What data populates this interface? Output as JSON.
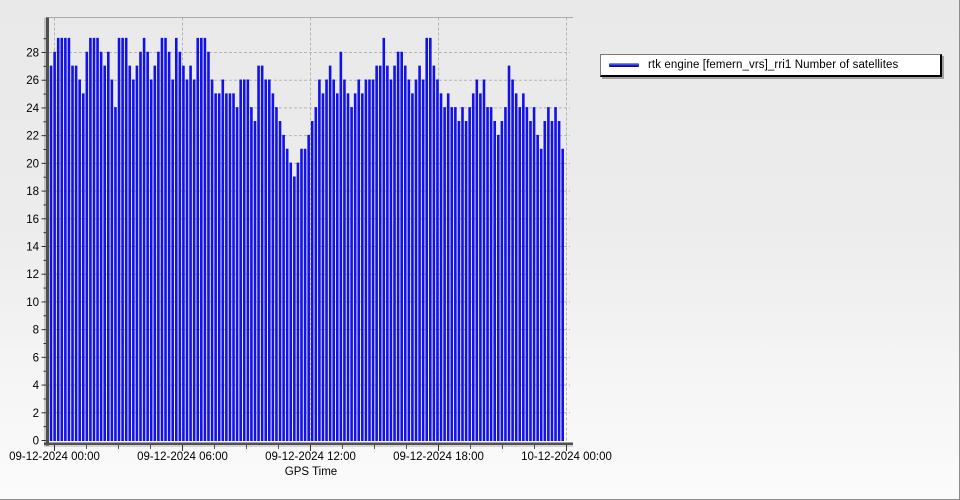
{
  "legend": {
    "label": "rtk engine [femern_vrs]_rri1 Number of satellites",
    "line_color": "#1212e8"
  },
  "chart_data": {
    "type": "line",
    "title": "",
    "xlabel": "GPS Time",
    "ylabel": "",
    "series_name": "rtk engine [femern_vrs]_rri1 Number of satellites",
    "line_color": "#1212e8",
    "grid": "dashed",
    "legend_position": "right-top",
    "ylim": [
      0,
      30.5
    ],
    "y_ticks": [
      0,
      2,
      4,
      6,
      8,
      10,
      12,
      14,
      16,
      18,
      20,
      22,
      24,
      26,
      28
    ],
    "x_tick_labels": [
      "09-12-2024 00:00",
      "09-12-2024 06:00",
      "09-12-2024 12:00",
      "09-12-2024 18:00",
      "10-12-2024 00:00"
    ],
    "x_start": "09-12-2024 00:00",
    "x_end": "10-12-2024 00:00",
    "sample_interval_minutes": 10,
    "note": "signal drops to 0 between samples forming dense comb; values below are the upper envelope (number of satellites)",
    "values": [
      27,
      28,
      29,
      29,
      29,
      29,
      27,
      27,
      26,
      25,
      28,
      29,
      29,
      29,
      28,
      27,
      28,
      26,
      24,
      29,
      29,
      29,
      27,
      26,
      27,
      28,
      29,
      28,
      26,
      27,
      28,
      29,
      29,
      28,
      26,
      29,
      28,
      27,
      26,
      27,
      26,
      29,
      29,
      29,
      28,
      26,
      25,
      25,
      26,
      25,
      25,
      25,
      24,
      26,
      26,
      26,
      24,
      23,
      27,
      27,
      26,
      26,
      25,
      24,
      23,
      22,
      21,
      20,
      19,
      20,
      21,
      21,
      22,
      23,
      24,
      26,
      25,
      26,
      27,
      26,
      25,
      28,
      26,
      25,
      24,
      25,
      26,
      25,
      26,
      26,
      26,
      27,
      27,
      29,
      27,
      26,
      27,
      28,
      28,
      27,
      26,
      25,
      26,
      27,
      26,
      29,
      29,
      27,
      26,
      25,
      24,
      25,
      24,
      24,
      23,
      24,
      23,
      24,
      25,
      26,
      25,
      26,
      24,
      24,
      23,
      22,
      23,
      24,
      27,
      26,
      25,
      24,
      25,
      24,
      23,
      24,
      22,
      21,
      23,
      24,
      23,
      24,
      23,
      21
    ]
  }
}
